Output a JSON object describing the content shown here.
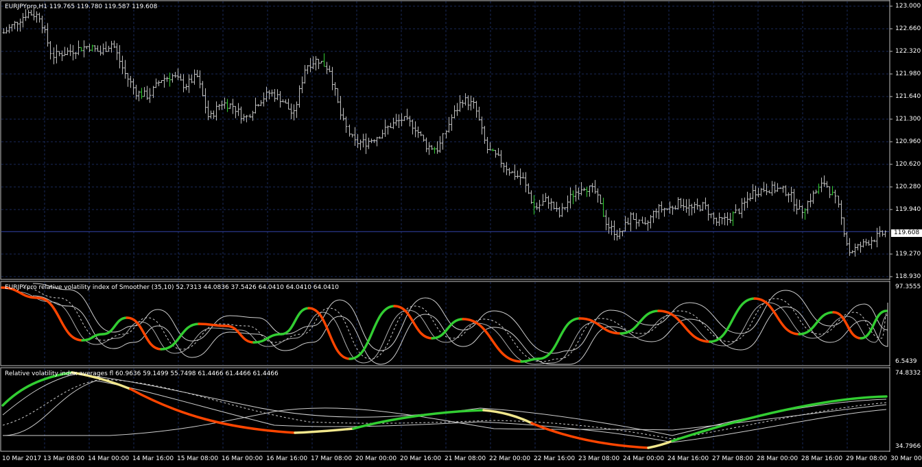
{
  "main": {
    "header": "EURJPYpro,H1  119.765 119.780 119.587 119.608",
    "price_levels": [
      "123.000",
      "122.660",
      "122.320",
      "121.980",
      "121.640",
      "121.300",
      "120.960",
      "120.620",
      "120.280",
      "119.940",
      "119.270",
      "118.930"
    ],
    "current_price": "119.608"
  },
  "ind1": {
    "header": "EURJPYpro relative volatility index of Smoother  (35,10) 52.7313 44.0836 37.5426 64.0410 64.0410 64.0410",
    "scale_max": "97.3555",
    "scale_min": "6.5439"
  },
  "ind2": {
    "header": "Relative volatility index averages fl 60.9636 59.1499 55.7498 61.4466 61.4466 61.4466",
    "scale_max": "74.8332",
    "scale_min": "34.7966"
  },
  "time_axis": [
    "10 Mar 2017",
    "13 Mar 08:00",
    "14 Mar 00:00",
    "14 Mar 16:00",
    "15 Mar 08:00",
    "16 Mar 00:00",
    "16 Mar 16:00",
    "17 Mar 08:00",
    "20 Mar 00:00",
    "20 Mar 16:00",
    "21 Mar 08:00",
    "22 Mar 00:00",
    "22 Mar 16:00",
    "23 Mar 08:00",
    "24 Mar 00:00",
    "24 Mar 16:00",
    "27 Mar 08:00",
    "28 Mar 00:00",
    "28 Mar 16:00",
    "29 Mar 08:00",
    "30 Mar 00:00"
  ],
  "colors": {
    "background": "#000000",
    "grid": "#1a2a5a",
    "bars": "#c0c0c0",
    "up": "#32cd32",
    "down": "#ff4500",
    "neutral": "#f0e68c"
  },
  "chart_data": {
    "type": "line",
    "title": "EURJPYpro,H1",
    "series": [
      {
        "name": "EURJPYpro",
        "values": [
          122.6,
          122.75,
          122.9,
          122.85,
          122.25,
          122.3,
          122.35,
          122.4,
          122.3,
          122.45,
          122.0,
          121.7,
          121.65,
          121.9,
          121.95,
          121.8,
          121.95,
          121.3,
          121.55,
          121.5,
          121.3,
          121.55,
          121.7,
          121.6,
          121.35,
          122.1,
          122.2,
          122.05,
          121.3,
          120.95,
          120.95,
          121.05,
          121.2,
          121.3,
          121.2,
          120.9,
          120.85,
          121.3,
          121.6,
          121.5,
          120.85,
          120.7,
          120.5,
          120.4,
          119.95,
          120.1,
          119.85,
          120.15,
          120.3,
          120.2,
          119.7,
          119.55,
          119.85,
          119.65,
          119.95,
          119.95,
          120.05,
          119.95,
          120.0,
          119.75,
          119.8,
          119.95,
          120.2,
          120.25,
          120.25,
          120.2,
          119.9,
          120.15,
          120.35,
          120.05,
          119.3,
          119.4,
          119.5,
          119.6
        ]
      }
    ]
  }
}
